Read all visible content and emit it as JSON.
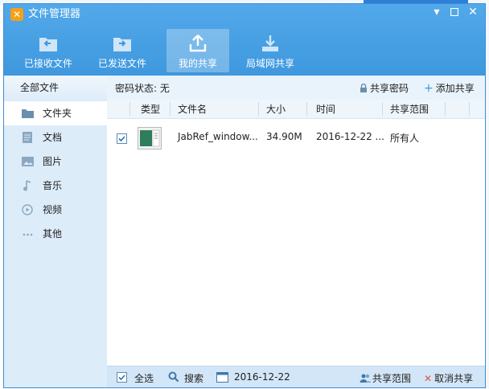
{
  "window": {
    "title": "文件管理器"
  },
  "toolbar": [
    {
      "label": "已接收文件",
      "icon": "received-files-icon"
    },
    {
      "label": "已发送文件",
      "icon": "sent-files-icon"
    },
    {
      "label": "我的共享",
      "icon": "my-share-icon"
    },
    {
      "label": "局域网共享",
      "icon": "lan-share-icon"
    }
  ],
  "sidebar": {
    "header": "全部文件",
    "items": [
      {
        "label": "文件夹",
        "icon": "folder-icon"
      },
      {
        "label": "文档",
        "icon": "document-icon"
      },
      {
        "label": "图片",
        "icon": "image-icon"
      },
      {
        "label": "音乐",
        "icon": "music-icon"
      },
      {
        "label": "视频",
        "icon": "video-icon"
      },
      {
        "label": "其他",
        "icon": "more-icon"
      }
    ]
  },
  "main": {
    "password_status_label": "密码状态: 无",
    "share_password": "共享密码",
    "add_share": "添加共享",
    "columns": {
      "type": "类型",
      "name": "文件名",
      "size": "大小",
      "time": "时间",
      "scope": "共享范围"
    },
    "rows": [
      {
        "name": "JabRef_window...",
        "size": "34.90M",
        "time": "2016-12-22 ...",
        "scope": "所有人",
        "checked": true
      }
    ]
  },
  "footer": {
    "select_all": "全选",
    "search": "搜索",
    "date": "2016-12-22",
    "share_scope": "共享范围",
    "cancel_share": "取消共享"
  },
  "colors": {
    "header": "#4aa3e6",
    "sidebar": "#ddecf9",
    "footer": "#d2e6f7",
    "accent": "#2f7fd8"
  }
}
